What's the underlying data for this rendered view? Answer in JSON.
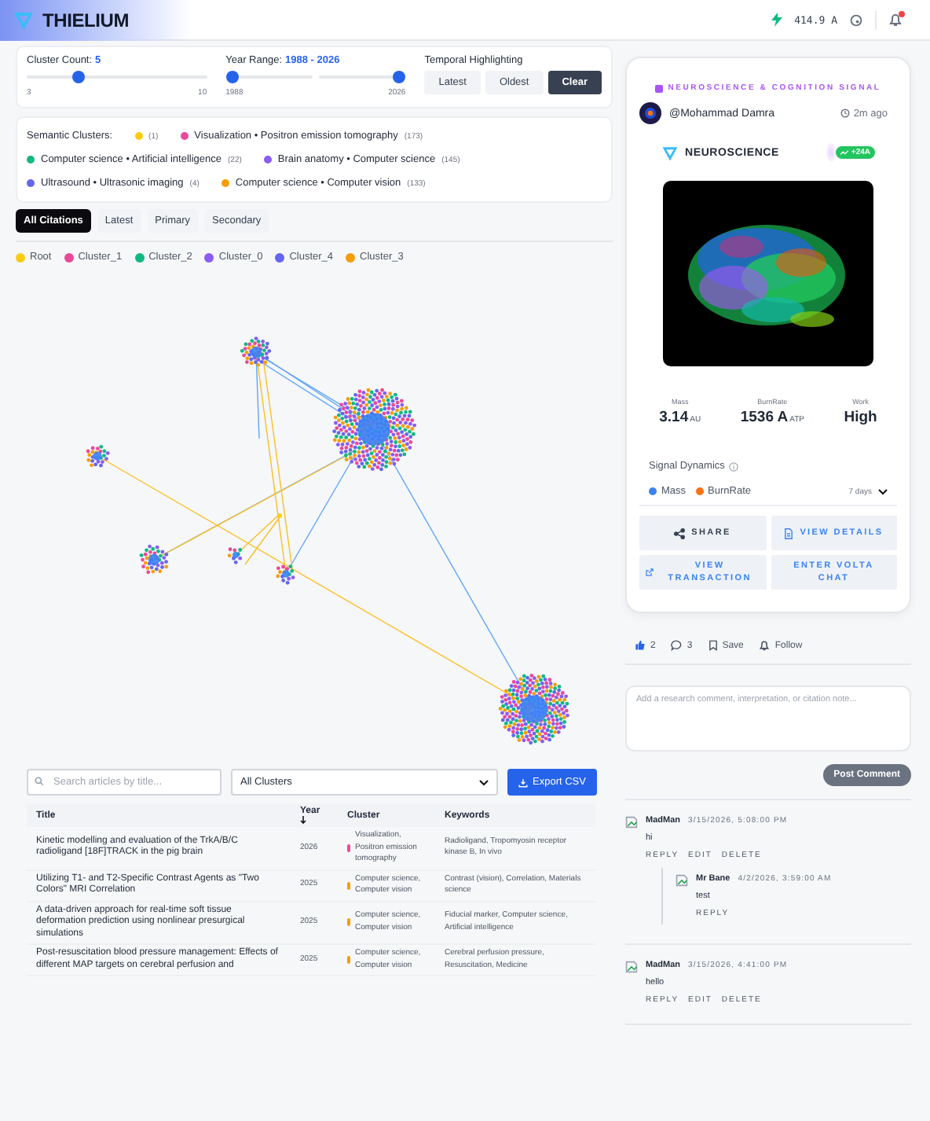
{
  "header": {
    "brand": "THIELIUM",
    "balance": "414.9 A",
    "notifications_unread": true
  },
  "controls": {
    "cluster_count": {
      "label": "Cluster Count:",
      "value": "5",
      "level": 0.29,
      "min": "3",
      "max": "10"
    },
    "year_range": {
      "label": "Year Range:",
      "value": "1988 - 2026",
      "sliders": [
        {
          "level": 0
        },
        {
          "level": 1
        }
      ],
      "min": "1988",
      "max": "2026"
    },
    "temporal": {
      "label": "Temporal Highlighting",
      "buttons": [
        {
          "label": "Latest",
          "selected": false
        },
        {
          "label": "Oldest",
          "selected": false
        },
        {
          "label": "Clear",
          "selected": true
        }
      ]
    }
  },
  "semantic_clusters": {
    "label": "Semantic Clusters:",
    "items": [
      {
        "count": "(1)",
        "color": "#facc15"
      },
      {
        "name": "Visualization • Positron emission tomography",
        "count": "(173)",
        "color": "#ec4899"
      },
      {
        "name": "Computer science • Artificial intelligence",
        "count": "(22)",
        "color": "#10b981"
      },
      {
        "name": "Brain anatomy • Computer science",
        "count": "(145)",
        "color": "#8b5cf6"
      },
      {
        "name": "Ultrasound • Ultrasonic imaging",
        "count": "(4)",
        "color": "#6366f1"
      },
      {
        "name": "Computer science • Computer vision",
        "count": "(133)",
        "color": "#f59e0b"
      }
    ]
  },
  "tabs": [
    {
      "label": "All Citations",
      "selected": true
    },
    {
      "label": "Latest",
      "selected": false
    },
    {
      "label": "Primary",
      "selected": false
    },
    {
      "label": "Secondary",
      "selected": false
    }
  ],
  "graph_legend": [
    {
      "label": "Root",
      "color": "#facc15"
    },
    {
      "label": "Cluster_1",
      "color": "#ec4899"
    },
    {
      "label": "Cluster_2",
      "color": "#10b981"
    },
    {
      "label": "Cluster_0",
      "color": "#8b5cf6"
    },
    {
      "label": "Cluster_4",
      "color": "#6366f1"
    },
    {
      "label": "Cluster_3",
      "color": "#f59e0b"
    }
  ],
  "table": {
    "search": {
      "placeholder": "Search articles by title..."
    },
    "filter": "All Clusters",
    "export": "Export CSV",
    "columns": [
      {
        "label": "Title",
        "sorted": false
      },
      {
        "label": "Year",
        "sorted": true
      },
      {
        "label": "Cluster",
        "sorted": false
      },
      {
        "label": "Keywords",
        "sorted": false
      }
    ],
    "rows": [
      {
        "title": "Kinetic modelling and evaluation of the TrkA/B/C radioligand [18F]TRACK in the pig brain",
        "year": "2026",
        "cluster": "Visualization, Positron emission tomography",
        "color": "#ec4899",
        "keywords": "Radioligand, Tropomyosin receptor kinase B, In vivo"
      },
      {
        "title": "Utilizing T1- and T2-Specific Contrast Agents as \"Two Colors\" MRI Correlation",
        "year": "2025",
        "cluster": "Computer science, Computer vision",
        "color": "#f59e0b",
        "keywords": "Contrast (vision), Correlation, Materials science"
      },
      {
        "title": "A data-driven approach for real-time soft tissue deformation prediction using nonlinear presurgical simulations",
        "year": "2025",
        "cluster": "Computer science, Computer vision",
        "color": "#f59e0b",
        "keywords": "Fiducial marker, Computer science, Artificial intelligence"
      },
      {
        "title": "Post-resuscitation blood pressure management: Effects of different MAP targets on cerebral perfusion and",
        "year": "2025",
        "cluster": "Computer science, Computer vision",
        "color": "#f59e0b",
        "keywords": "Cerebral perfusion pressure, Resuscitation, Medicine"
      }
    ]
  },
  "signal_card": {
    "category": "NEUROSCIENCE & COGNITION SIGNAL",
    "author": "@Mohammad Damra",
    "time": "2m ago",
    "topic": "NEUROSCIENCE",
    "badge": "+24A",
    "stats": [
      {
        "label": "Mass",
        "value": "3.14",
        "unit": "AU"
      },
      {
        "label": "BurnRate",
        "value": "1536 A",
        "unit": "ATP"
      },
      {
        "label": "Work",
        "value": "High"
      }
    ],
    "dynamics": {
      "title": "Signal Dynamics",
      "series": [
        {
          "name": "Mass",
          "color": "#3b82f6"
        },
        {
          "name": "BurnRate",
          "color": "#f97316"
        }
      ],
      "range": "7 days"
    },
    "actions": [
      {
        "label": "SHARE",
        "kind": "share"
      },
      {
        "label": "VIEW DETAILS",
        "kind": "details"
      },
      {
        "label": "VIEW TRANSACTION",
        "kind": "transaction"
      },
      {
        "label": "ENTER VOLTA CHAT",
        "kind": "chat"
      }
    ]
  },
  "engagement": {
    "likes": "2",
    "comments": "3",
    "save": "Save",
    "follow": "Follow"
  },
  "comment_box": {
    "placeholder": "Add a research comment, interpretation, or citation note...",
    "submit": "Post Comment"
  },
  "comments": [
    {
      "author": "MadMan",
      "time": "3/15/2026, 5:08:00 PM",
      "text": "hi",
      "actions": [
        "REPLY",
        "EDIT",
        "DELETE"
      ],
      "replies": [
        {
          "author": "Mr Bane",
          "time": "4/2/2026, 3:59:00 AM",
          "text": "test",
          "actions": [
            "REPLY"
          ]
        }
      ]
    },
    {
      "author": "MadMan",
      "time": "3/15/2026, 4:41:00 PM",
      "text": "hello",
      "actions": [
        "REPLY",
        "EDIT",
        "DELETE"
      ]
    }
  ]
}
